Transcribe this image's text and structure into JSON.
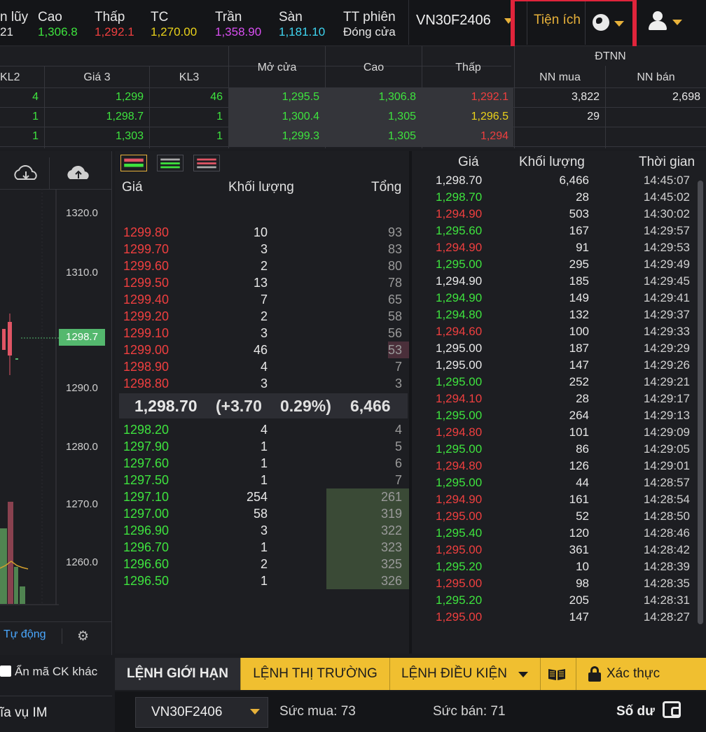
{
  "header": {
    "stats": [
      {
        "label": "n lũy",
        "value": "21",
        "color": "white"
      },
      {
        "label": "Cao",
        "value": "1,306.8",
        "color": "green"
      },
      {
        "label": "Thấp",
        "value": "1,292.1",
        "color": "red"
      },
      {
        "label": "TC",
        "value": "1,270.00",
        "color": "yellow"
      },
      {
        "label": "Trần",
        "value": "1,358.90",
        "color": "purple"
      },
      {
        "label": "Sàn",
        "value": "1,181.10",
        "color": "cyan"
      },
      {
        "label": "TT phiên",
        "value": "Đóng cửa",
        "color": "white"
      }
    ],
    "symbol": "VN30F2406",
    "utilities_label": "Tiện ích",
    "globe_icon": "globe-icon",
    "user_icon": "user-icon"
  },
  "board": {
    "headers": {
      "kl2": "KL2",
      "gia3": "Giá 3",
      "kl3": "KL3",
      "open": "Mở cửa",
      "high": "Cao",
      "low": "Thấp",
      "foreign_group": "ĐTNN",
      "nn_buy": "NN mua",
      "nn_sell": "NN bán"
    },
    "rows": [
      {
        "kl2": "4",
        "gia3": "1,299",
        "kl3": "46",
        "open": "1,295.5",
        "high": "1,306.8",
        "low": "1,292.1",
        "low_color": "red",
        "nn_buy": "3,822",
        "nn_sell": "2,698"
      },
      {
        "kl2": "1",
        "gia3": "1,298.7",
        "kl3": "1",
        "open": "1,300.4",
        "high": "1,305",
        "low": "1,296.5",
        "low_color": "yellow",
        "nn_buy": "29",
        "nn_sell": ""
      },
      {
        "kl2": "1",
        "gia3": "1,303",
        "kl3": "1",
        "open": "1,299.3",
        "high": "1,305",
        "low": "1,294",
        "low_color": "red",
        "nn_buy": "",
        "nn_sell": ""
      }
    ]
  },
  "chart": {
    "yticks": [
      "1320.0",
      "1310.0",
      "1290.0",
      "1280.0",
      "1270.0",
      "1260.0"
    ],
    "last_price": "1298.7",
    "auto_label": "Tự động",
    "hide_other_label": "Ẩn mã CK khác",
    "im_service_label": "ĩa vụ IM"
  },
  "orderbook": {
    "headers": {
      "price": "Giá",
      "volume": "Khối lượng",
      "total": "Tổng"
    },
    "asks": [
      {
        "price": "1299.80",
        "volume": "10",
        "total": "93"
      },
      {
        "price": "1299.70",
        "volume": "3",
        "total": "83"
      },
      {
        "price": "1299.60",
        "volume": "2",
        "total": "80"
      },
      {
        "price": "1299.50",
        "volume": "13",
        "total": "78"
      },
      {
        "price": "1299.40",
        "volume": "7",
        "total": "65"
      },
      {
        "price": "1299.20",
        "volume": "2",
        "total": "58"
      },
      {
        "price": "1299.10",
        "volume": "3",
        "total": "56"
      },
      {
        "price": "1299.00",
        "volume": "46",
        "total": "53"
      },
      {
        "price": "1298.90",
        "volume": "4",
        "total": "7"
      },
      {
        "price": "1298.80",
        "volume": "3",
        "total": "3"
      }
    ],
    "last": {
      "price": "1,298.70",
      "change": "(+3.70",
      "pct": "0.29%)",
      "volume": "6,466"
    },
    "bids": [
      {
        "price": "1298.20",
        "volume": "4",
        "total": "4"
      },
      {
        "price": "1297.90",
        "volume": "1",
        "total": "5"
      },
      {
        "price": "1297.60",
        "volume": "1",
        "total": "6"
      },
      {
        "price": "1297.50",
        "volume": "1",
        "total": "7"
      },
      {
        "price": "1297.10",
        "volume": "254",
        "total": "261"
      },
      {
        "price": "1297.00",
        "volume": "58",
        "total": "319"
      },
      {
        "price": "1296.90",
        "volume": "3",
        "total": "322"
      },
      {
        "price": "1296.70",
        "volume": "1",
        "total": "323"
      },
      {
        "price": "1296.60",
        "volume": "2",
        "total": "325"
      },
      {
        "price": "1296.50",
        "volume": "1",
        "total": "326"
      }
    ]
  },
  "trades": {
    "headers": {
      "price": "Giá",
      "volume": "Khối lượng",
      "time": "Thời gian"
    },
    "rows": [
      {
        "price": "1,298.70",
        "color": "white",
        "volume": "6,466",
        "time": "14:45:07"
      },
      {
        "price": "1,298.70",
        "color": "green",
        "volume": "28",
        "time": "14:45:02"
      },
      {
        "price": "1,294.90",
        "color": "red",
        "volume": "503",
        "time": "14:30:02"
      },
      {
        "price": "1,295.60",
        "color": "green",
        "volume": "167",
        "time": "14:29:57"
      },
      {
        "price": "1,294.90",
        "color": "red",
        "volume": "91",
        "time": "14:29:53"
      },
      {
        "price": "1,295.00",
        "color": "green",
        "volume": "295",
        "time": "14:29:49"
      },
      {
        "price": "1,294.90",
        "color": "white",
        "volume": "185",
        "time": "14:29:45"
      },
      {
        "price": "1,294.90",
        "color": "green",
        "volume": "149",
        "time": "14:29:41"
      },
      {
        "price": "1,294.80",
        "color": "green",
        "volume": "132",
        "time": "14:29:37"
      },
      {
        "price": "1,294.60",
        "color": "red",
        "volume": "100",
        "time": "14:29:33"
      },
      {
        "price": "1,295.00",
        "color": "white",
        "volume": "187",
        "time": "14:29:29"
      },
      {
        "price": "1,295.00",
        "color": "white",
        "volume": "147",
        "time": "14:29:26"
      },
      {
        "price": "1,295.00",
        "color": "green",
        "volume": "252",
        "time": "14:29:21"
      },
      {
        "price": "1,294.10",
        "color": "red",
        "volume": "28",
        "time": "14:29:17"
      },
      {
        "price": "1,295.00",
        "color": "green",
        "volume": "264",
        "time": "14:29:13"
      },
      {
        "price": "1,294.80",
        "color": "red",
        "volume": "101",
        "time": "14:29:09"
      },
      {
        "price": "1,295.00",
        "color": "green",
        "volume": "86",
        "time": "14:29:05"
      },
      {
        "price": "1,294.80",
        "color": "red",
        "volume": "126",
        "time": "14:29:01"
      },
      {
        "price": "1,295.00",
        "color": "green",
        "volume": "44",
        "time": "14:28:57"
      },
      {
        "price": "1,294.90",
        "color": "red",
        "volume": "161",
        "time": "14:28:54"
      },
      {
        "price": "1,295.00",
        "color": "red",
        "volume": "52",
        "time": "14:28:50"
      },
      {
        "price": "1,295.40",
        "color": "green",
        "volume": "120",
        "time": "14:28:46"
      },
      {
        "price": "1,295.00",
        "color": "red",
        "volume": "361",
        "time": "14:28:42"
      },
      {
        "price": "1,295.20",
        "color": "green",
        "volume": "10",
        "time": "14:28:39"
      },
      {
        "price": "1,295.00",
        "color": "red",
        "volume": "98",
        "time": "14:28:35"
      },
      {
        "price": "1,295.20",
        "color": "green",
        "volume": "205",
        "time": "14:28:31"
      },
      {
        "price": "1,295.00",
        "color": "red",
        "volume": "147",
        "time": "14:28:27"
      }
    ]
  },
  "order_tabs": {
    "limit": "LỆNH GIỚI HẠN",
    "market": "LỆNH THỊ TRƯỜNG",
    "conditional": "LỆNH ĐIỀU KIỆN",
    "verify": "Xác thực"
  },
  "bottom": {
    "symbol": "VN30F2406",
    "buy_power": "Sức mua: 73",
    "sell_power": "Sức bán: 71",
    "balance": "Số dư"
  },
  "colors": {
    "green": "#3ee33e",
    "red": "#ef3f3f",
    "yellow": "#ead21a",
    "accent": "#f0bf30",
    "highlight": "#e0243b"
  }
}
